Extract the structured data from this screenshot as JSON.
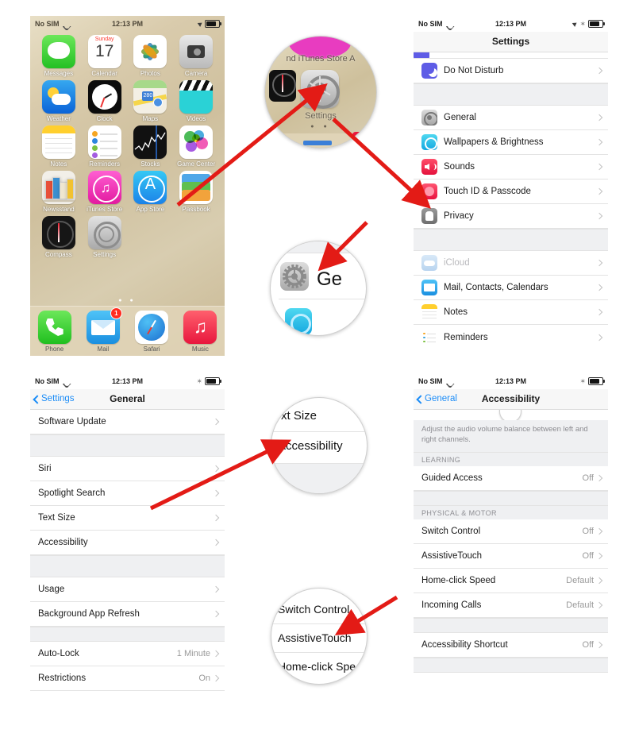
{
  "statusbar": {
    "carrier": "No SIM",
    "time": "12:13 PM",
    "bt": "✶"
  },
  "homescreen": {
    "rows": [
      [
        {
          "label": "Messages",
          "icon": "messages-icon"
        },
        {
          "label": "Calendar",
          "icon": "calendar-icon",
          "day": "Sunday",
          "date": "17"
        },
        {
          "label": "Photos",
          "icon": "photos-icon"
        },
        {
          "label": "Camera",
          "icon": "camera-icon"
        }
      ],
      [
        {
          "label": "Weather",
          "icon": "weather-icon"
        },
        {
          "label": "Clock",
          "icon": "clock-icon"
        },
        {
          "label": "Maps",
          "icon": "maps-icon",
          "shield": "280"
        },
        {
          "label": "Videos",
          "icon": "videos-icon"
        }
      ],
      [
        {
          "label": "Notes",
          "icon": "notes-icon"
        },
        {
          "label": "Reminders",
          "icon": "reminders-icon"
        },
        {
          "label": "Stocks",
          "icon": "stocks-icon"
        },
        {
          "label": "Game Center",
          "icon": "game-center-icon"
        }
      ],
      [
        {
          "label": "Newsstand",
          "icon": "newsstand-icon"
        },
        {
          "label": "iTunes Store",
          "icon": "itunes-store-icon"
        },
        {
          "label": "App Store",
          "icon": "app-store-icon"
        },
        {
          "label": "Passbook",
          "icon": "passbook-icon"
        }
      ],
      [
        {
          "label": "Compass",
          "icon": "compass-icon"
        },
        {
          "label": "Settings",
          "icon": "settings-icon"
        }
      ]
    ],
    "dock": [
      {
        "label": "Phone",
        "icon": "phone-icon"
      },
      {
        "label": "Mail",
        "icon": "mail-icon",
        "badge": "1"
      },
      {
        "label": "Safari",
        "icon": "safari-icon"
      },
      {
        "label": "Music",
        "icon": "music-icon"
      }
    ],
    "pagedots": "● ●"
  },
  "settings_screen": {
    "title": "Settings",
    "rows": [
      {
        "label": "Do Not Disturb",
        "icon": "moon-icon"
      },
      {
        "label": "General",
        "icon": "gear-icon"
      },
      {
        "label": "Wallpapers & Brightness",
        "icon": "wallpaper-icon"
      },
      {
        "label": "Sounds",
        "icon": "speaker-icon"
      },
      {
        "label": "Touch ID & Passcode",
        "icon": "fingerprint-icon"
      },
      {
        "label": "Privacy",
        "icon": "hand-icon"
      },
      {
        "label": "iCloud",
        "icon": "cloud-icon",
        "dim": true
      },
      {
        "label": "Mail, Contacts, Calendars",
        "icon": "envelope-icon"
      },
      {
        "label": "Notes",
        "icon": "notepad-icon"
      },
      {
        "label": "Reminders",
        "icon": "checklist-icon"
      }
    ]
  },
  "general_screen": {
    "back": "Settings",
    "title": "General",
    "rows": [
      {
        "label": "Software Update"
      },
      {
        "label": "Siri"
      },
      {
        "label": "Spotlight Search"
      },
      {
        "label": "Text Size"
      },
      {
        "label": "Accessibility"
      },
      {
        "label": "Usage"
      },
      {
        "label": "Background App Refresh"
      },
      {
        "label": "Auto-Lock",
        "value": "1 Minute"
      },
      {
        "label": "Restrictions",
        "value": "On"
      }
    ]
  },
  "accessibility_screen": {
    "back": "General",
    "title": "Accessibility",
    "blurb": "Adjust the audio volume balance between left and right channels.",
    "section_learning": "LEARNING",
    "section_physical": "PHYSICAL & MOTOR",
    "rows": [
      {
        "label": "Guided Access",
        "value": "Off"
      },
      {
        "label": "Switch Control",
        "value": "Off"
      },
      {
        "label": "AssistiveTouch",
        "value": "Off"
      },
      {
        "label": "Home-click Speed",
        "value": "Default"
      },
      {
        "label": "Incoming Calls",
        "value": "Default"
      },
      {
        "label": "Accessibility Shortcut",
        "value": "Off"
      }
    ]
  },
  "magnifiers": {
    "one": {
      "name": "settings-app-magnifier",
      "label": "Settings",
      "top_labels": "nd  iTunes Store   A"
    },
    "two": {
      "name": "general-row-magnifier",
      "text": "Ge"
    },
    "three": {
      "name": "accessibility-row-magnifier",
      "above": "xt Size",
      "text": "Accessibility"
    },
    "four": {
      "name": "assistivetouch-row-magnifier",
      "above": "Switch Control",
      "text": "AssistiveTouch",
      "below": "Home-click Spe"
    }
  },
  "colors": {
    "accent_blue": "#1b8cf7",
    "arrow_red": "#e31b16",
    "group_bg": "#eff0f2",
    "separator": "#e3e3e3"
  }
}
